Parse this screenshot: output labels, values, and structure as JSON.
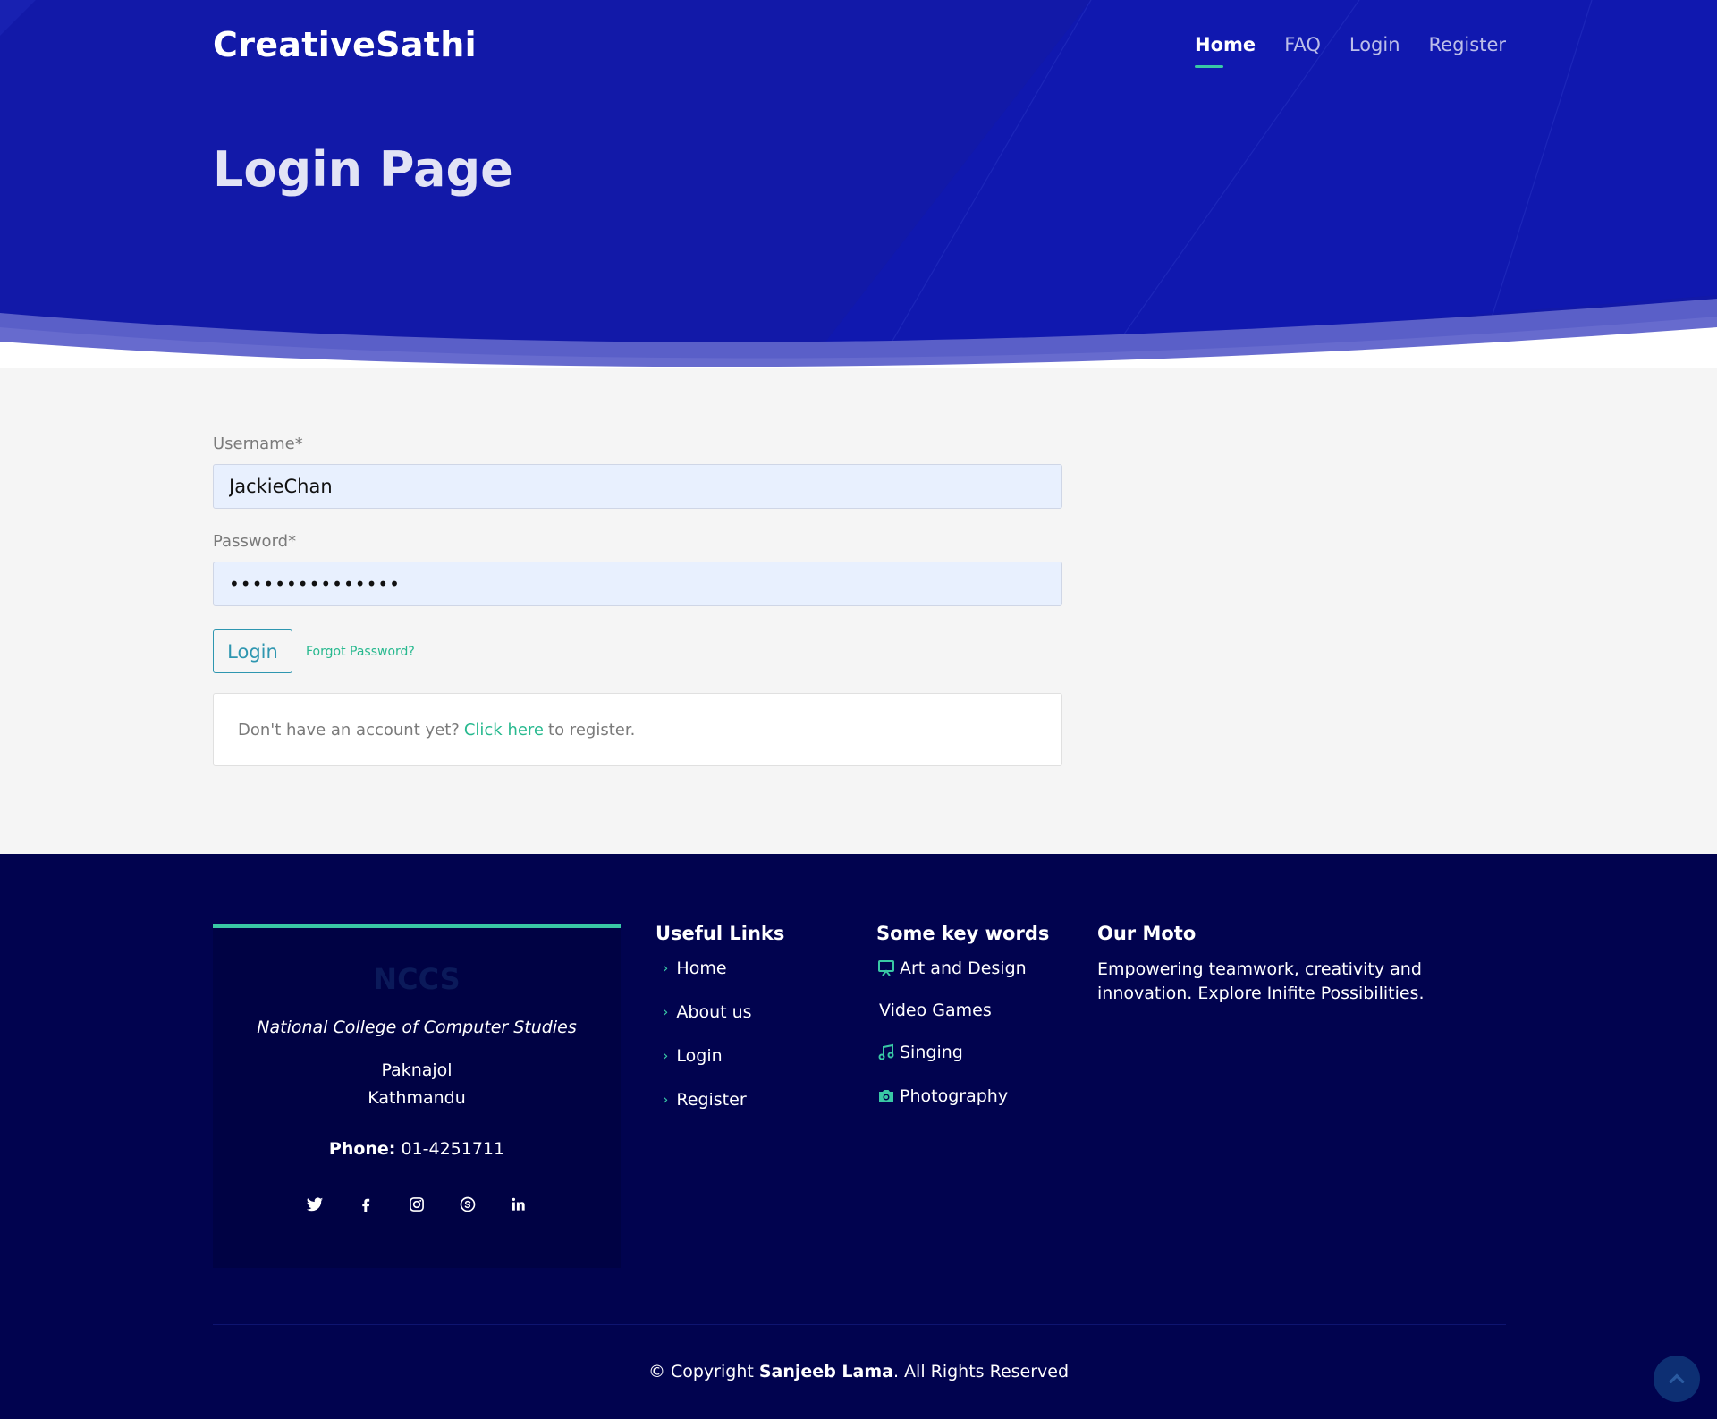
{
  "header": {
    "brand": "CreativeSathi",
    "nav": [
      {
        "label": "Home",
        "active": true
      },
      {
        "label": "FAQ",
        "active": false
      },
      {
        "label": "Login",
        "active": false
      },
      {
        "label": "Register",
        "active": false
      }
    ],
    "page_title": "Login Page"
  },
  "form": {
    "username_label": "Username*",
    "username_value": "JackieChan",
    "password_label": "Password*",
    "password_value": "•••••••••••••••",
    "login_button": "Login",
    "forgot_password": "Forgot Password?",
    "register_prompt": "Don't have an account yet?",
    "register_link": "Click here",
    "register_suffix": "to register."
  },
  "footer": {
    "card": {
      "logo_text": "NCCS",
      "name": "National College of Computer Studies",
      "address_line1": "Paknajol",
      "address_line2": "Kathmandu",
      "phone_label": "Phone:",
      "phone_value": "01-4251711"
    },
    "socials": [
      "twitter-icon",
      "facebook-icon",
      "instagram-icon",
      "skype-icon",
      "linkedin-icon"
    ],
    "useful_links": {
      "title": "Useful Links",
      "items": [
        "Home",
        "About us",
        "Login",
        "Register"
      ]
    },
    "keywords": {
      "title": "Some key words",
      "items": [
        {
          "label": "Art and Design",
          "icon": "easel-icon"
        },
        {
          "label": "Video Games",
          "icon": ""
        },
        {
          "label": "Singing",
          "icon": "music-note-icon"
        },
        {
          "label": "Photography",
          "icon": "camera-icon"
        }
      ]
    },
    "moto": {
      "title": "Our Moto",
      "text": "Empowering teamwork, creativity and innovation. Explore Inifite Possibilities."
    },
    "copyright_prefix": "© Copyright",
    "copyright_name": "Sanjeeb Lama",
    "copyright_suffix": ". All Rights Reserved"
  },
  "colors": {
    "hero": "#1219a8",
    "footer": "#01034f",
    "accent": "#39c8a5",
    "button": "#2e96b0"
  }
}
